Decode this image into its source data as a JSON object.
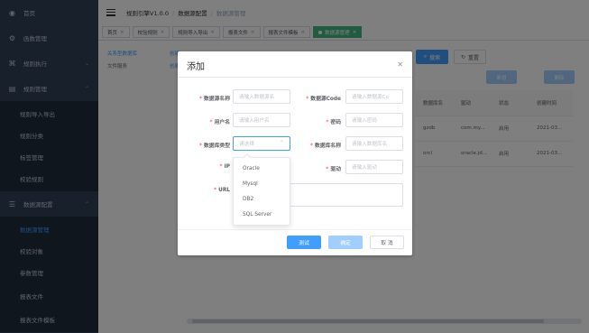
{
  "sidebar": {
    "items": [
      {
        "label": "首页",
        "icon": "dashboard-icon"
      },
      {
        "label": "函数管理",
        "icon": "gear-icon"
      },
      {
        "label": "规则执行",
        "icon": "network-icon"
      },
      {
        "label": "规则管理",
        "icon": "document-icon"
      },
      {
        "label": "规则导入导出"
      },
      {
        "label": "规则分类"
      },
      {
        "label": "标签管理"
      },
      {
        "label": "校验规则"
      },
      {
        "label": "数据源配置",
        "icon": "sliders-icon"
      },
      {
        "label": "数据源管理"
      },
      {
        "label": "校验对象"
      },
      {
        "label": "参数管理"
      },
      {
        "label": "报表文件"
      },
      {
        "label": "报表文件模板"
      }
    ]
  },
  "header": {
    "crumbs": [
      "规则引擎V1.0.0",
      "数据源配置",
      "数据源管理"
    ]
  },
  "tags": [
    {
      "label": "首页",
      "active": false
    },
    {
      "label": "校验规则",
      "active": false
    },
    {
      "label": "规则导入导出",
      "active": false
    },
    {
      "label": "报表文件",
      "active": false
    },
    {
      "label": "报表文件模板",
      "active": false
    },
    {
      "label": "数据源管理",
      "active": true
    }
  ],
  "main": {
    "tree": [
      {
        "label": "关系型数据库",
        "action": "创建"
      },
      {
        "label": "文件服务",
        "action": "创建"
      }
    ],
    "search_btn": "搜索",
    "reset_btn": "重置",
    "btn_a": "新增",
    "btn_b": "删除",
    "table": {
      "headers": [
        "数据库名",
        "驱动",
        "状态",
        "创建时间"
      ],
      "rows": [
        [
          "gzdb",
          "com.my...",
          "启用",
          "2021-03..."
        ],
        [
          "orcl",
          "oracle.jd...",
          "启用",
          "2021-03..."
        ]
      ]
    }
  },
  "dialog": {
    "title": "添加",
    "fields": {
      "ds_name_label": "数据源名称",
      "ds_name_ph": "请输入数据源名",
      "ds_code_label": "数据源Code",
      "ds_code_ph": "请输入数据源Co",
      "user_label": "用户名",
      "user_ph": "请输入用户名",
      "pwd_label": "密码",
      "pwd_ph": "请输入密码",
      "dbtype_label": "数据库类型",
      "dbtype_ph": "请选择",
      "dbname_label": "数据库名称",
      "dbname_ph": "请输入数据库名",
      "ip_label": "IP",
      "driver_label": "驱动",
      "driver_ph": "请输入驱动",
      "url_label": "URL"
    },
    "buttons": {
      "test": "测试",
      "confirm": "确定",
      "cancel": "取 消"
    },
    "dbtype_options": [
      "Oracle",
      "Mysql",
      "DB2",
      "SQL Server"
    ]
  }
}
